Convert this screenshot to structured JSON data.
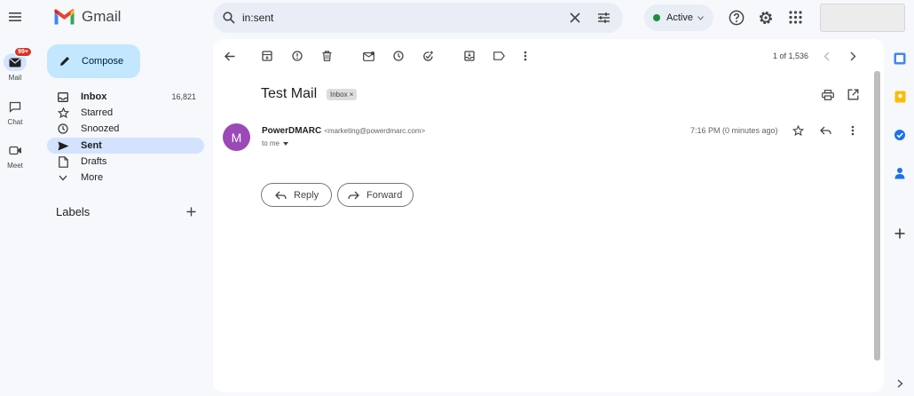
{
  "app": {
    "name": "Gmail"
  },
  "rail": {
    "mail": {
      "label": "Mail",
      "badge": "99+"
    },
    "chat": {
      "label": "Chat"
    },
    "meet": {
      "label": "Meet"
    }
  },
  "search": {
    "query": "in:sent"
  },
  "status": {
    "label": "Active",
    "color": "#1e8e3e"
  },
  "compose": {
    "label": "Compose"
  },
  "nav": {
    "items": [
      {
        "label": "Inbox",
        "count": "16,821",
        "icon": "inbox-icon"
      },
      {
        "label": "Starred",
        "icon": "star-icon"
      },
      {
        "label": "Snoozed",
        "icon": "clock-icon"
      },
      {
        "label": "Sent",
        "icon": "send-icon",
        "active": true
      },
      {
        "label": "Drafts",
        "icon": "draft-icon"
      },
      {
        "label": "More",
        "icon": "chevron-down-icon"
      }
    ],
    "labels_title": "Labels"
  },
  "toolbar": {
    "pagination": "1 of 1,536"
  },
  "message": {
    "subject": "Test Mail",
    "label_chip": "Inbox ×",
    "avatar_letter": "M",
    "sender_name": "PowerDMARC",
    "sender_email": "<marketing@powerdmarc.com>",
    "to": "to me",
    "timestamp": "7:16 PM (0 minutes ago)"
  },
  "actions": {
    "reply": "Reply",
    "forward": "Forward"
  },
  "colors": {
    "accent": "#c2e7ff",
    "active_nav": "#d3e3fd",
    "avatar": "#9a49b6",
    "badge": "#d93025"
  }
}
